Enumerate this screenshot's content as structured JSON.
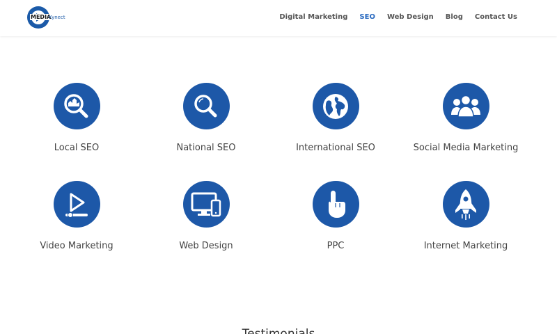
{
  "header": {
    "logo": {
      "name_part1": "MEDIA",
      "name_part2": "Kynect",
      "icon": "play-logo-icon"
    },
    "nav": [
      {
        "label": "Digital Marketing",
        "active": false
      },
      {
        "label": "SEO",
        "active": true
      },
      {
        "label": "Web Design",
        "active": false
      },
      {
        "label": "Blog",
        "active": false
      },
      {
        "label": "Contact Us",
        "active": false
      }
    ]
  },
  "colors": {
    "accent": "#1d58a8",
    "nav_active": "#2a6ac0",
    "nav_text": "#555555"
  },
  "services": [
    {
      "label": "Local SEO",
      "icon": "magnifier-city-icon"
    },
    {
      "label": "National SEO",
      "icon": "magnifier-icon"
    },
    {
      "label": "International SEO",
      "icon": "globe-icon"
    },
    {
      "label": "Social Media Marketing",
      "icon": "people-group-icon"
    },
    {
      "label": "Video Marketing",
      "icon": "video-play-icon"
    },
    {
      "label": "Web Design",
      "icon": "devices-icon"
    },
    {
      "label": "PPC",
      "icon": "pointer-hand-icon"
    },
    {
      "label": "Internet Marketing",
      "icon": "rocket-icon"
    }
  ],
  "testimonials": {
    "heading": "Testimonials"
  }
}
